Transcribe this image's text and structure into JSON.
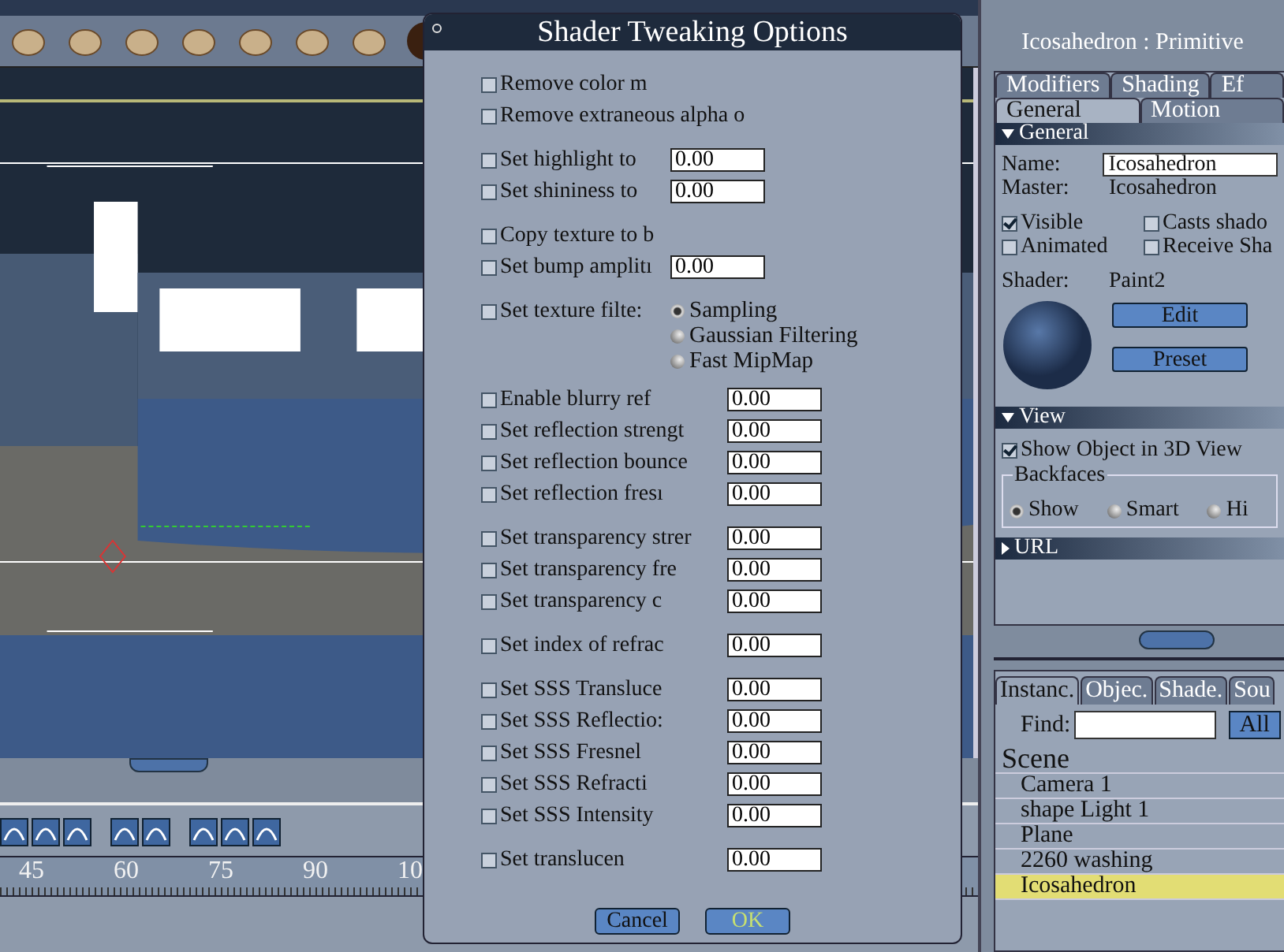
{
  "timeline": {
    "ruler_labels": [
      "45",
      "60",
      "75",
      "90",
      "10"
    ]
  },
  "dialog": {
    "title": "Shader Tweaking Options",
    "groups": [
      [
        {
          "kind": "check",
          "label": "Remove color m",
          "checked": false
        },
        {
          "kind": "check",
          "label": "Remove extraneous alpha o",
          "checked": false
        }
      ],
      [
        {
          "kind": "field",
          "label": "Set highlight to",
          "checked": false,
          "value": "0.00"
        },
        {
          "kind": "field",
          "label": "Set shininess to",
          "checked": false,
          "value": "0.00"
        }
      ],
      [
        {
          "kind": "check",
          "label": "Copy texture to b",
          "checked": false
        },
        {
          "kind": "field",
          "label": "Set bump amplitı",
          "checked": false,
          "value": "0.00"
        }
      ],
      [
        {
          "kind": "radio",
          "label": "Set texture filte:",
          "checked": false,
          "options": [
            {
              "label": "Sampling",
              "selected": true
            },
            {
              "label": "Gaussian Filtering",
              "selected": false
            },
            {
              "label": "Fast MipMap",
              "selected": false
            }
          ]
        }
      ],
      [
        {
          "kind": "field",
          "label": "Enable blurry ref",
          "checked": false,
          "value": "0.00"
        },
        {
          "kind": "field",
          "label": "Set reflection strengt",
          "checked": false,
          "value": "0.00"
        },
        {
          "kind": "field",
          "label": "Set reflection bounce",
          "checked": false,
          "value": "0.00"
        },
        {
          "kind": "field",
          "label": "Set reflection fresı",
          "checked": false,
          "value": "0.00"
        }
      ],
      [
        {
          "kind": "field",
          "label": "Set transparency strer",
          "checked": false,
          "value": "0.00"
        },
        {
          "kind": "field",
          "label": "Set transparency fre",
          "checked": false,
          "value": "0.00"
        },
        {
          "kind": "field",
          "label": "Set transparency c",
          "checked": false,
          "value": "0.00"
        }
      ],
      [
        {
          "kind": "field",
          "label": "Set index of refrac",
          "checked": false,
          "value": "0.00"
        }
      ],
      [
        {
          "kind": "field",
          "label": "Set SSS Transluce",
          "checked": false,
          "value": "0.00"
        },
        {
          "kind": "field",
          "label": "Set SSS Reflectio:",
          "checked": false,
          "value": "0.00"
        },
        {
          "kind": "field",
          "label": "Set SSS Fresnel",
          "checked": false,
          "value": "0.00"
        },
        {
          "kind": "field",
          "label": "Set SSS Refracti",
          "checked": false,
          "value": "0.00"
        },
        {
          "kind": "field",
          "label": "Set SSS Intensity",
          "checked": false,
          "value": "0.00"
        }
      ],
      [
        {
          "kind": "field",
          "label": "Set translucen",
          "checked": false,
          "value": "0.00"
        }
      ]
    ],
    "buttons": [
      {
        "label": "Cancel",
        "default": false
      },
      {
        "label": "OK",
        "default": true
      }
    ]
  },
  "properties": {
    "title": "Icosahedron : Primitive",
    "tabs_row_1": [
      {
        "label": "Modifiers",
        "selected": false
      },
      {
        "label": "Shading",
        "selected": false
      },
      {
        "label": "Ef",
        "selected": false
      }
    ],
    "tabs_row_2": [
      {
        "label": "General",
        "selected": true
      },
      {
        "label": "Motion",
        "selected": false
      }
    ],
    "general": {
      "header": "General",
      "expanded": true,
      "name_label": "Name:",
      "name_value": "Icosahedron",
      "master_label": "Master:",
      "master_value": "Icosahedron",
      "checkboxes": [
        {
          "label": "Visible",
          "checked": true
        },
        {
          "label": "Casts shado",
          "checked": false
        },
        {
          "label": "Animated",
          "checked": false
        },
        {
          "label": "Receive Sha",
          "checked": false
        }
      ],
      "shader_label": "Shader:",
      "shader_value": "Paint2",
      "buttons": [
        "Edit",
        "Preset"
      ]
    },
    "view": {
      "header": "View",
      "expanded": true,
      "show_object": {
        "label": "Show Object in 3D View",
        "checked": true
      },
      "backfaces": {
        "legend": "Backfaces",
        "options": [
          {
            "label": "Show",
            "selected": true
          },
          {
            "label": "Smart",
            "selected": false
          },
          {
            "label": "Hi",
            "selected": false
          }
        ]
      }
    },
    "url": {
      "header": "URL",
      "expanded": false
    }
  },
  "browser": {
    "tabs": [
      {
        "label": "Instanc.",
        "selected": true
      },
      {
        "label": "Objec.",
        "selected": false
      },
      {
        "label": "Shade.",
        "selected": false
      },
      {
        "label": "Sou",
        "selected": false
      }
    ],
    "find_label": "Find:",
    "all_button": "All",
    "tree": [
      {
        "label": "Scene",
        "selected": false,
        "children": [
          {
            "label": "Camera 1",
            "selected": false
          },
          {
            "label": "shape Light 1",
            "selected": false
          },
          {
            "label": "Plane",
            "selected": false
          },
          {
            "label": "2260 washing",
            "selected": false
          },
          {
            "label": "Icosahedron",
            "selected": true
          }
        ]
      }
    ]
  }
}
